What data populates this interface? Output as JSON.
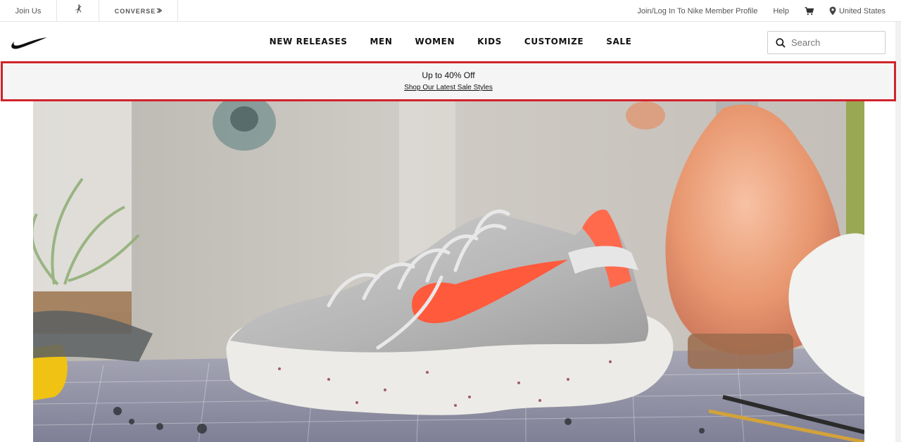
{
  "topbar": {
    "join_label": "Join Us",
    "jordan_icon": "jordan-jumpman-icon",
    "converse_label": "CONVERSE",
    "login_label": "Join/Log In To Nike Member Profile",
    "help_label": "Help",
    "cart_icon": "cart-icon",
    "location_icon": "location-pin-icon",
    "location_label": "United States"
  },
  "header": {
    "logo_icon": "nike-swoosh-icon",
    "nav": [
      "NEW RELEASES",
      "MEN",
      "WOMEN",
      "KIDS",
      "CUSTOMIZE",
      "SALE"
    ],
    "search": {
      "placeholder": "Search",
      "icon": "search-icon"
    }
  },
  "promo": {
    "title": "Up to 40% Off",
    "link": "Shop Our Latest Sale Styles",
    "border_color": "#d0232b"
  },
  "hero": {
    "image": "sneaker-product-photo",
    "accent_color": "#ff5a3c"
  }
}
